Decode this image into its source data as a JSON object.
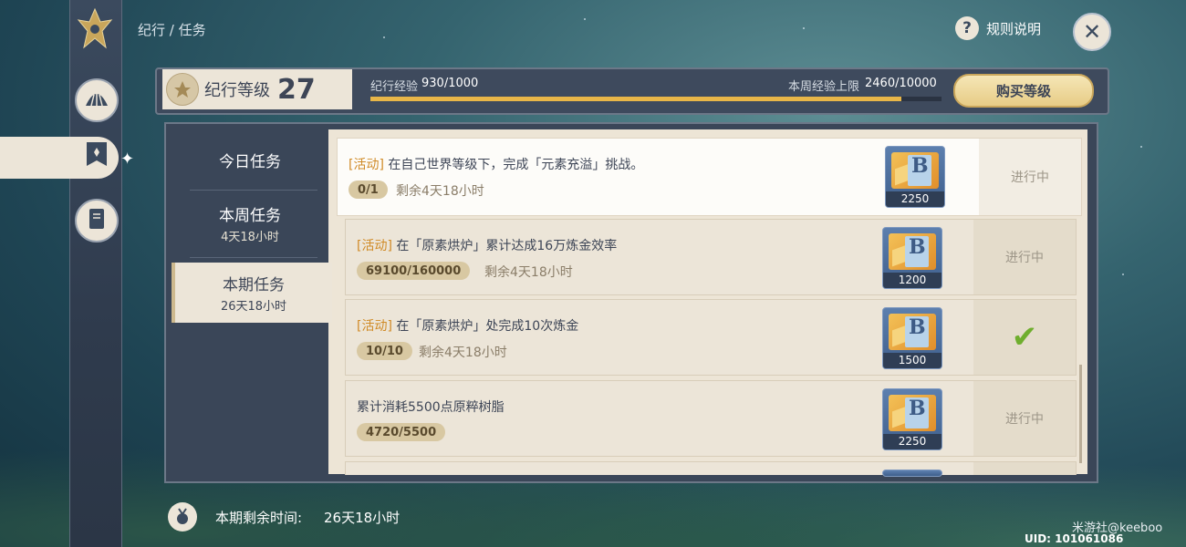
{
  "header": {
    "breadcrumb": "纪行 / 任务",
    "help_label": "规则说明",
    "close_icon": "close-icon"
  },
  "level": {
    "label": "纪行等级",
    "value": "27",
    "exp_label": "纪行经验",
    "exp_value": "930/1000",
    "exp_progress": 0.93,
    "weekly_label": "本周经验上限",
    "weekly_value": "2460/10000",
    "buy_label": "购买等级"
  },
  "tabs": [
    {
      "title": "今日任务",
      "subtitle": ""
    },
    {
      "title": "本周任务",
      "subtitle": "4天18小时"
    },
    {
      "title": "本期任务",
      "subtitle": "26天18小时"
    }
  ],
  "active_tab": 2,
  "tasks": [
    {
      "tag": "[活动]",
      "title": "在自己世界等级下，完成「元素充溢」挑战。",
      "progress": "0/1",
      "remain": "剩余4天18小时",
      "reward": "2250",
      "status": "进行中"
    },
    {
      "tag": "[活动]",
      "title": "在「原素烘炉」累计达成16万炼金效率",
      "progress": "69100/160000",
      "remain": "剩余4天18小时",
      "reward": "1200",
      "status": "进行中"
    },
    {
      "tag": "[活动]",
      "title": "在「原素烘炉」处完成10次炼金",
      "progress": "10/10",
      "remain": "剩余4天18小时",
      "reward": "1500",
      "status": "完成"
    },
    {
      "tag": "",
      "title": "累计消耗5500点原粹树脂",
      "progress": "4720/5500",
      "remain": "",
      "reward": "2250",
      "status": "进行中"
    }
  ],
  "footer": {
    "label": "本期剩余时间:",
    "value": "26天18小时",
    "watermark": "米游社@keeboo",
    "uid": "UID: 101061086"
  },
  "colors": {
    "accent_gold": "#e8b648",
    "activity_tag": "#d08a26",
    "panel_dark": "#3a4658",
    "panel_light": "#ece5d8",
    "check_green": "#6fae2e"
  }
}
